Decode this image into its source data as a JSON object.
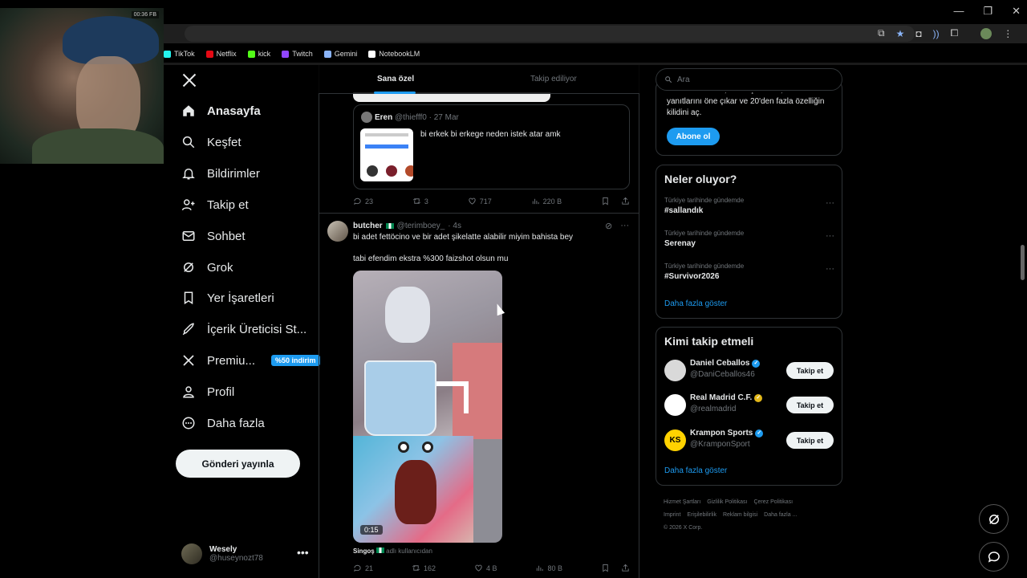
{
  "browser": {
    "bookmarks": [
      {
        "label": "TikTok",
        "color": "#25f4ee"
      },
      {
        "label": "Netflix",
        "color": "#e50914"
      },
      {
        "label": "kick",
        "color": "#53fc18"
      },
      {
        "label": "Twitch",
        "color": "#9146ff"
      },
      {
        "label": "Gemini",
        "color": "#8ab4f8"
      },
      {
        "label": "NotebookLM",
        "color": "#ffffff"
      }
    ],
    "window_controls": {
      "minimize": "—",
      "maximize": "❐",
      "close": "✕"
    }
  },
  "pip": {
    "badge": "00:36 FB"
  },
  "nav": {
    "items": [
      {
        "label": "Anasayfa",
        "icon": "home-icon"
      },
      {
        "label": "Keşfet",
        "icon": "search-icon"
      },
      {
        "label": "Bildirimler",
        "icon": "bell-icon"
      },
      {
        "label": "Takip et",
        "icon": "add-user-icon"
      },
      {
        "label": "Sohbet",
        "icon": "mail-icon"
      },
      {
        "label": "Grok",
        "icon": "grok-icon"
      },
      {
        "label": "Yer İşaretleri",
        "icon": "bookmark-icon"
      },
      {
        "label": "İçerik Üreticisi St...",
        "icon": "rocket-icon"
      },
      {
        "label": "Premiu...",
        "icon": "x-icon"
      },
      {
        "label": "Profil",
        "icon": "person-icon"
      },
      {
        "label": "Daha fazla",
        "icon": "more-circle-icon"
      }
    ],
    "premium_badge": "%50 indirim",
    "post_button": "Gönderi yayınla",
    "account": {
      "name": "Wesely",
      "handle": "@huseynozt78"
    }
  },
  "feed": {
    "tabs": [
      "Sana özel",
      "Takip ediliyor"
    ],
    "quote": {
      "name": "Eren",
      "handle": "@thiefff0",
      "date": "· 27 Mar",
      "text": "bi erkek bi erkege neden istek atar amk"
    },
    "post1_actions": {
      "replies": "23",
      "reposts": "3",
      "likes": "717",
      "views": "220 B"
    },
    "post2": {
      "name": "butcher",
      "handle": "@terimboey_",
      "time": "· 4s",
      "line1": "bi adet fettöcino ve bir adet şikelatte alabilir miyim bahista bey",
      "line2": "tabi efendim ekstra %300 faizshot olsun mu",
      "video_time": "0:15",
      "caption_name": "Singoş",
      "caption_rest": "adlı kullanıcıdan"
    },
    "post2_actions": {
      "replies": "21",
      "reposts": "162",
      "likes": "4 B",
      "views": "80 B"
    }
  },
  "right": {
    "search_placeholder": "Ara",
    "premium_text_partial": "Reklamları azalt, kazanç elde et,",
    "premium_text": "yanıtlarını öne çıkar ve 20'den fazla özelliğin kilidini aç.",
    "subscribe": "Abone ol",
    "trends_title": "Neler oluyor?",
    "trends": [
      {
        "context": "Türkiye tarihinde gündemde",
        "name": "#sallandık"
      },
      {
        "context": "Türkiye tarihinde gündemde",
        "name": "Serenay"
      },
      {
        "context": "Türkiye tarihinde gündemde",
        "name": "#Survivor2026"
      }
    ],
    "show_more": "Daha fazla göster",
    "who_title": "Kimi takip etmeli",
    "who": [
      {
        "name": "Daniel Ceballos",
        "handle": "@DaniCeballos46",
        "follow": "Takip et",
        "avatar_color": "#d9d9d9"
      },
      {
        "name": "Real Madrid C.F.",
        "handle": "@realmadrid",
        "follow": "Takip et",
        "avatar_color": "#ffffff"
      },
      {
        "name": "Krampon Sports",
        "handle": "@KramponSport",
        "follow": "Takip et",
        "avatar_color": "#ffd200"
      }
    ],
    "who_more": "Daha fazla göster",
    "footer": [
      "Hizmet Şartları",
      "Gizlilik Politikası",
      "Çerez Politikası",
      "Imprint",
      "Erişilebilirlik",
      "Reklam bilgisi",
      "Daha fazla ...",
      "© 2026 X Corp."
    ]
  }
}
